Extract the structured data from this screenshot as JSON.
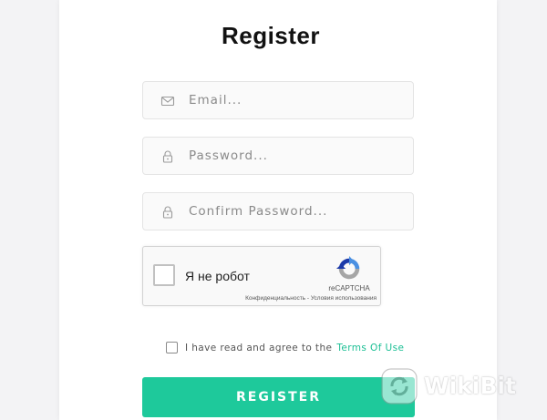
{
  "form": {
    "title": "Register",
    "email": {
      "placeholder": "Email...",
      "value": "",
      "icon": "mail-icon"
    },
    "password": {
      "placeholder": "Password...",
      "value": "",
      "icon": "lock-icon"
    },
    "confirm_password": {
      "placeholder": "Confirm Password...",
      "value": "",
      "icon": "lock-icon"
    },
    "agree_text": "I have read and agree to the",
    "terms_link": "Terms Of Use",
    "submit_label": "REGISTER"
  },
  "recaptcha": {
    "label": "Я не робот",
    "brand": "reCAPTCHA",
    "links": "Конфиденциальность - Условия использования"
  },
  "watermark": {
    "text": "WikiBit"
  },
  "colors": {
    "accent": "#1ec99b",
    "link": "#1bbf94",
    "page_background": "#f3f3f5",
    "card_background": "#ffffff"
  }
}
